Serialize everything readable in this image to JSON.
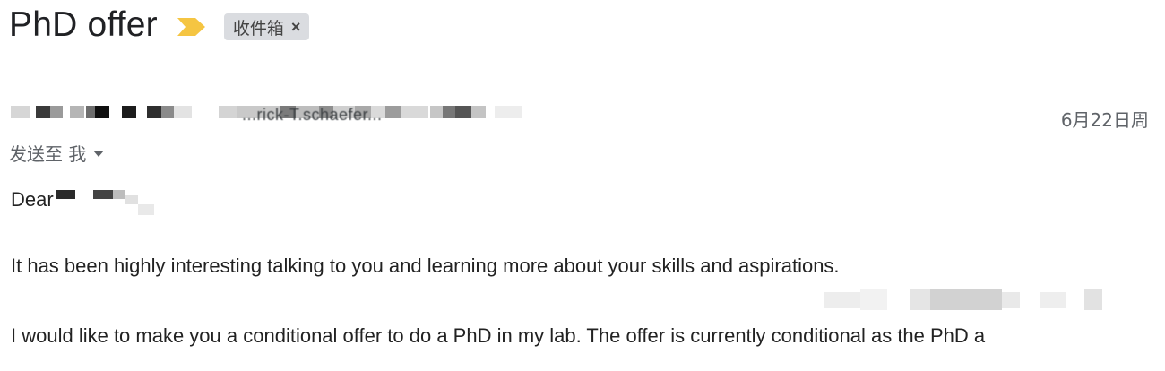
{
  "subject": "PhD offer",
  "importance_marker": {
    "icon": "importance-marker-icon",
    "color": "#f5c542"
  },
  "label": {
    "text": "收件箱",
    "close": "×"
  },
  "sender": {
    "email_fragment": "...rick-T.schaefer...",
    "redacted": true
  },
  "date": "6月22日周",
  "recipient": {
    "text": "发送至 我",
    "icon": "chevron-down-icon"
  },
  "body": {
    "greeting": "Dear",
    "paragraph_1": "It has been highly interesting talking to you and learning more about your skills and aspirations.",
    "paragraph_2": "I would like to make you a conditional offer to do a PhD in my lab. The offer is currently conditional as the PhD a"
  }
}
